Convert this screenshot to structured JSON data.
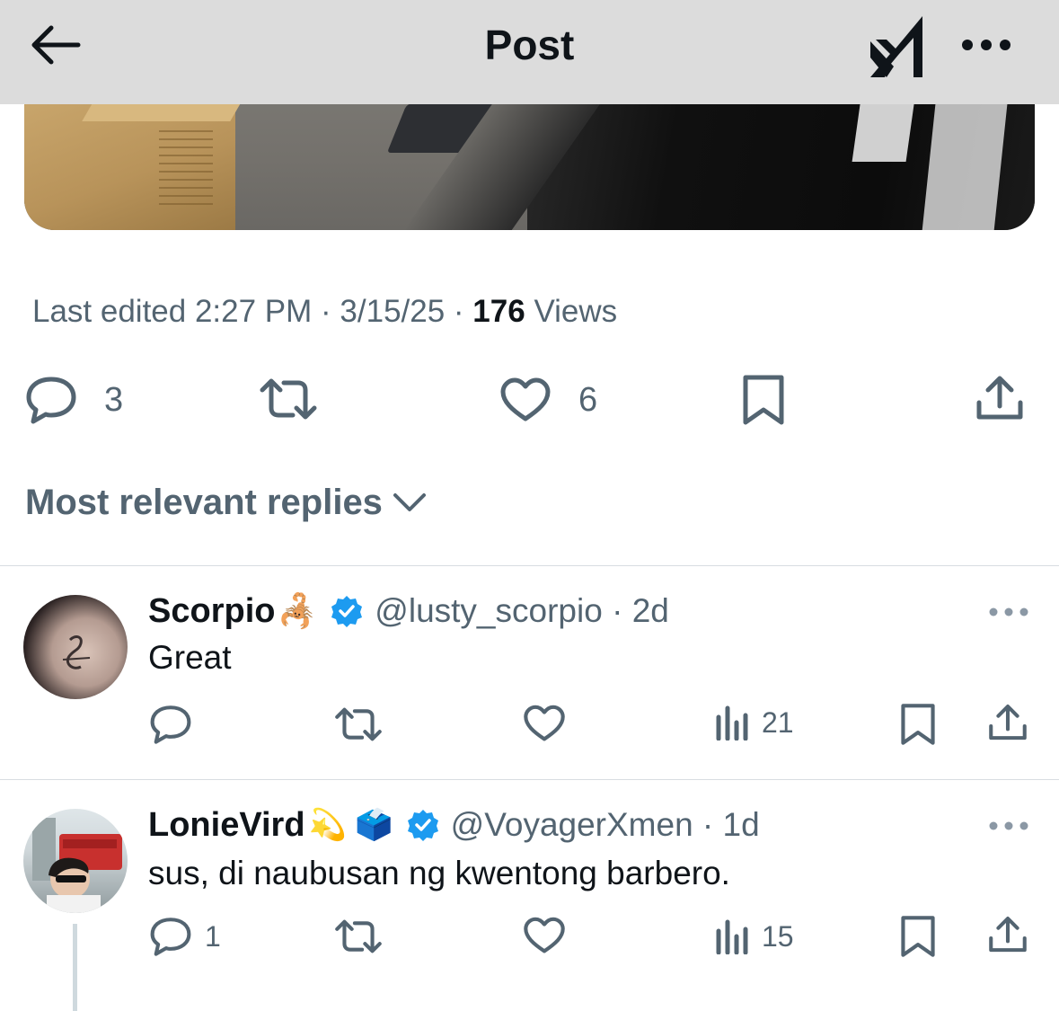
{
  "header": {
    "title": "Post",
    "back_icon": "arrow-left-icon",
    "grok_icon": "grok-logo-icon",
    "more_icon": "more-horizontal-icon"
  },
  "post": {
    "meta": {
      "edited_label": "Last edited 2:27 PM · 3/15/25",
      "separator": " · ",
      "views_count": "176",
      "views_label": "Views"
    },
    "actions": {
      "reply_count": "3",
      "repost_count": "",
      "like_count": "6"
    }
  },
  "replies_section": {
    "sort_label": "Most relevant replies"
  },
  "replies": [
    {
      "name": "Scorpio",
      "name_emoji": "🦂",
      "verified": true,
      "handle": "@lusty_scorpio",
      "time": "2d",
      "text": "Great",
      "reply_count": "",
      "views": "21"
    },
    {
      "name": "LonieVird",
      "name_emoji": "💫 🗳️",
      "verified": true,
      "handle": "@VoyagerXmen",
      "time": "1d",
      "text": "sus, di naubusan ng kwentong barbero.",
      "reply_count": "1",
      "views": "15"
    }
  ],
  "colors": {
    "header_bg": "#dcdcdc",
    "text_primary": "#0f1419",
    "text_secondary": "#536471",
    "verified_blue": "#1d9bf0",
    "divider": "#d8dde1"
  }
}
